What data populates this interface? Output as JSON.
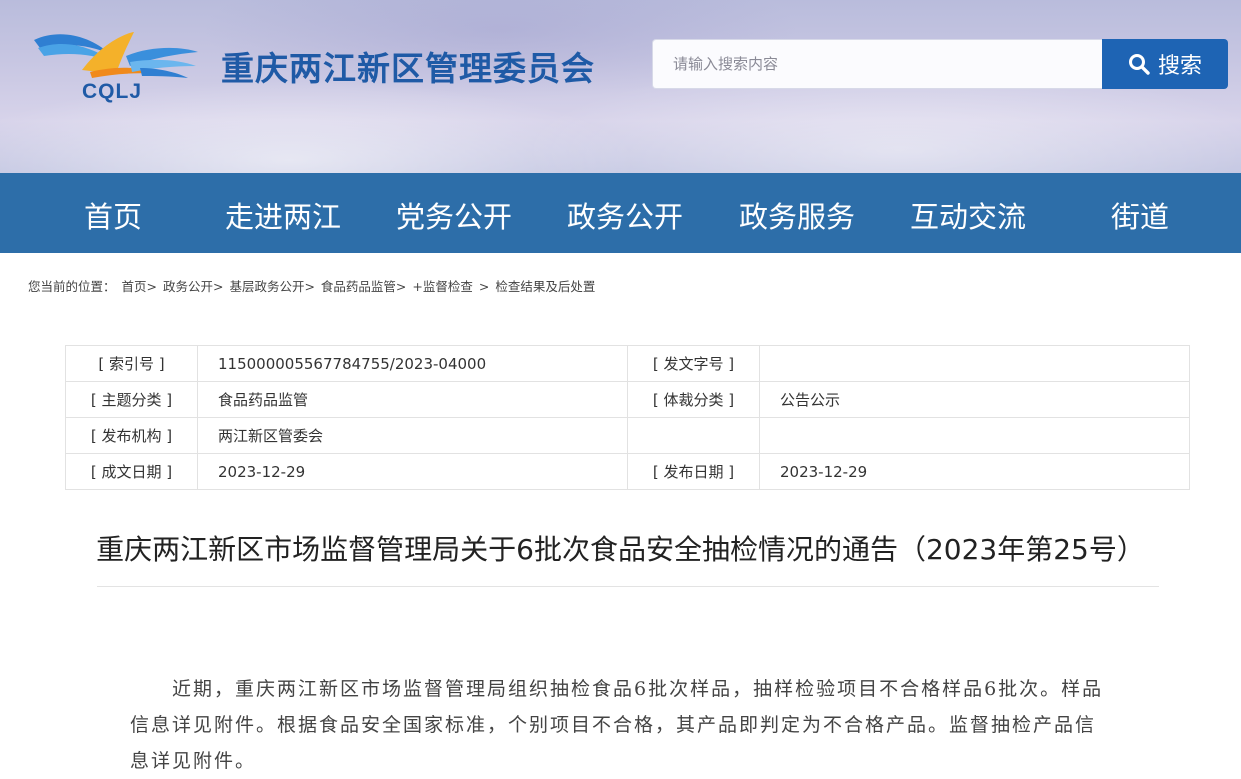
{
  "header": {
    "logo_text": "CQLJ",
    "site_title": "重庆两江新区管理委员会",
    "search": {
      "placeholder": "请输入搜索内容",
      "button_label": "搜索"
    }
  },
  "nav": {
    "items": [
      {
        "label": "首页"
      },
      {
        "label": "走进两江"
      },
      {
        "label": "党务公开"
      },
      {
        "label": "政务公开"
      },
      {
        "label": "政务服务"
      },
      {
        "label": "互动交流"
      },
      {
        "label": "街道"
      }
    ]
  },
  "breadcrumb": {
    "prefix": "您当前的位置：",
    "items": [
      "首页>",
      "政务公开>",
      "基层政务公开>",
      "食品药品监管>",
      "+监督检查",
      ">",
      "检查结果及后处置"
    ]
  },
  "meta": {
    "rows": [
      {
        "k1": "[ 索引号 ]",
        "v1": "115000005567784755/2023-04000",
        "k2": "[ 发文字号 ]",
        "v2": ""
      },
      {
        "k1": "[ 主题分类 ]",
        "v1": "食品药品监管",
        "k2": "[ 体裁分类 ]",
        "v2": "公告公示"
      },
      {
        "k1": "[ 发布机构 ]",
        "v1": "两江新区管委会",
        "k2": "",
        "v2": ""
      },
      {
        "k1": "[ 成文日期 ]",
        "v1": "2023-12-29",
        "k2": "[ 发布日期 ]",
        "v2": "2023-12-29"
      }
    ]
  },
  "article": {
    "title": "重庆两江新区市场监督管理局关于6批次食品安全抽检情况的通告（2023年第25号）",
    "paragraph": "近期，重庆两江新区市场监督管理局组织抽检食品6批次样品，抽样检验项目不合格样品6批次。样品信息详见附件。根据食品安全国家标准，个别项目不合格，其产品即判定为不合格产品。监督抽检产品信息详见附件。"
  },
  "colors": {
    "brand": "#1f5aa6",
    "nav_bg": "#2d6ea9",
    "search_btn": "#1e64b4"
  }
}
